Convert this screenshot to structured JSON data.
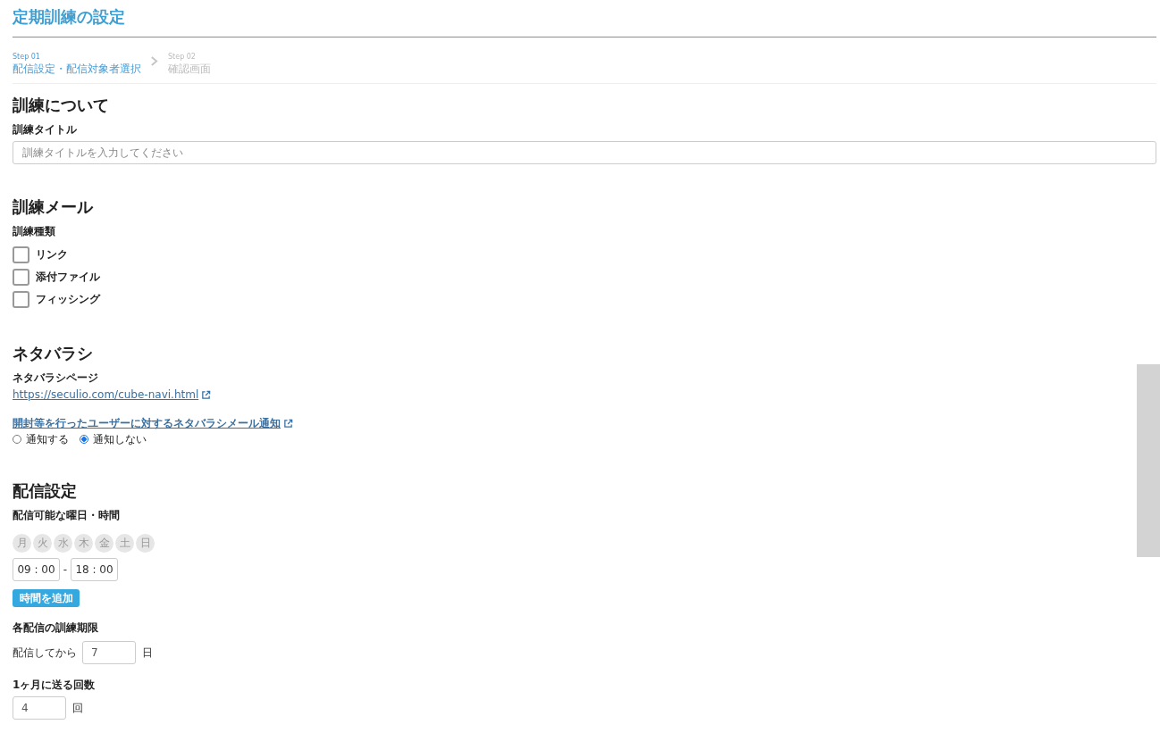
{
  "page": {
    "title": "定期訓練の設定"
  },
  "steps": [
    {
      "number": "Step 01",
      "label": "配信設定・配信対象者選択",
      "selected": true
    },
    {
      "number": "Step 02",
      "label": "確認画面",
      "selected": false
    }
  ],
  "training": {
    "heading": "訓練について",
    "title_label": "訓練タイトル",
    "title_field": {
      "placeholder": "訓練タイトルを入力してください"
    }
  },
  "mail": {
    "heading": "訓練メール",
    "types_label": "訓練種類",
    "types": [
      {
        "label": "リンク",
        "checked": false
      },
      {
        "label": "添付ファイル",
        "checked": false
      },
      {
        "label": "フィッシング",
        "checked": false
      }
    ]
  },
  "reveal": {
    "heading": "ネタバラシ",
    "page_label": "ネタバラシページ",
    "page_link": "https://seculio.com/cube-navi.html",
    "notify_link": "開封等を行ったユーザーに対するネタバラシメール通知",
    "notify_options": [
      {
        "label": "通知する",
        "selected": false
      },
      {
        "label": "通知しない",
        "selected": true
      }
    ]
  },
  "delivery": {
    "heading": "配信設定",
    "days_label": "配信可能な曜日・時間",
    "days": [
      {
        "label": "月",
        "selected": false
      },
      {
        "label": "火",
        "selected": false
      },
      {
        "label": "水",
        "selected": false
      },
      {
        "label": "木",
        "selected": false
      },
      {
        "label": "金",
        "selected": false
      },
      {
        "label": "土",
        "selected": false
      },
      {
        "label": "日",
        "selected": false
      }
    ],
    "time_from": "09 : 00",
    "time_separator": "-",
    "time_to": "18 : 00",
    "add_time_button": "時間を追加",
    "deadline_label": "各配信の訓練期限",
    "deadline_prefix": "配信してから",
    "deadline_value": "7",
    "deadline_unit": "日",
    "count_label": "1ヶ月に送る回数",
    "count_value": "4",
    "count_unit": "回"
  }
}
